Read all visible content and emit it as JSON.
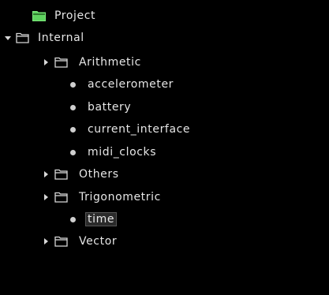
{
  "colors": {
    "background": "#000000",
    "text": "#e6e6e6",
    "project_folder": "#5fd35f",
    "folder_outline": "#d8d8d8",
    "selection_bg": "#2a2a2a"
  },
  "tree": {
    "project": {
      "label": "Project",
      "icon": "folder-open-icon",
      "expanded": false
    },
    "internal": {
      "label": "Internal",
      "icon": "folder-outline-icon",
      "expanded": true
    },
    "arithmetic": {
      "label": "Arithmetic",
      "icon": "folder-outline-icon",
      "expanded": false
    },
    "items": [
      {
        "label": "accelerometer",
        "icon": "bullet-icon"
      },
      {
        "label": "battery",
        "icon": "bullet-icon"
      },
      {
        "label": "current_interface",
        "icon": "bullet-icon"
      },
      {
        "label": "midi_clocks",
        "icon": "bullet-icon"
      }
    ],
    "others": {
      "label": "Others",
      "icon": "folder-outline-icon",
      "expanded": false
    },
    "trigonometric": {
      "label": "Trigonometric",
      "icon": "folder-outline-icon",
      "expanded": false
    },
    "time": {
      "label": "time",
      "icon": "bullet-icon",
      "selected": true
    },
    "vector": {
      "label": "Vector",
      "icon": "folder-outline-icon",
      "expanded": false
    }
  }
}
